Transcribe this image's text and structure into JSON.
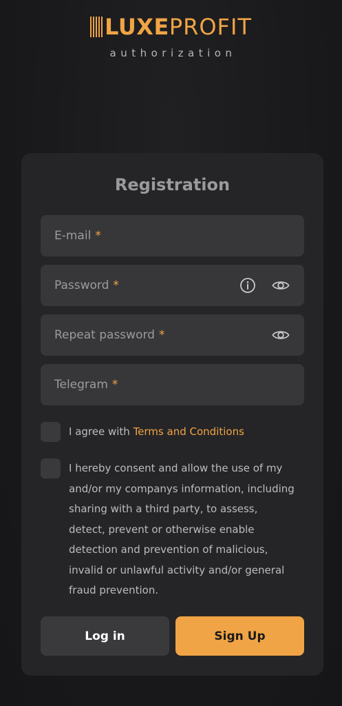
{
  "brand": {
    "logo_bold": "LUXE",
    "logo_light": "PROFIT",
    "subtitle": "authorization",
    "accent_color": "#f0a445"
  },
  "form": {
    "title": "Registration",
    "fields": [
      {
        "label": "E-mail",
        "required": "*"
      },
      {
        "label": "Password",
        "required": "*",
        "icons": [
          "info-icon",
          "eye-icon"
        ]
      },
      {
        "label": "Repeat password",
        "required": "*",
        "icons": [
          "eye-icon"
        ]
      },
      {
        "label": "Telegram",
        "required": "*"
      }
    ],
    "terms": {
      "prefix": "I agree with ",
      "link": "Terms and Conditions"
    },
    "consent": "I hereby consent and allow the use of my and/or my companys information, including sharing with a third party, to assess, detect, prevent or otherwise enable detection and prevention of malicious, invalid or unlawful activity and/or general fraud prevention.",
    "login_label": "Log in",
    "signup_label": "Sign Up"
  }
}
